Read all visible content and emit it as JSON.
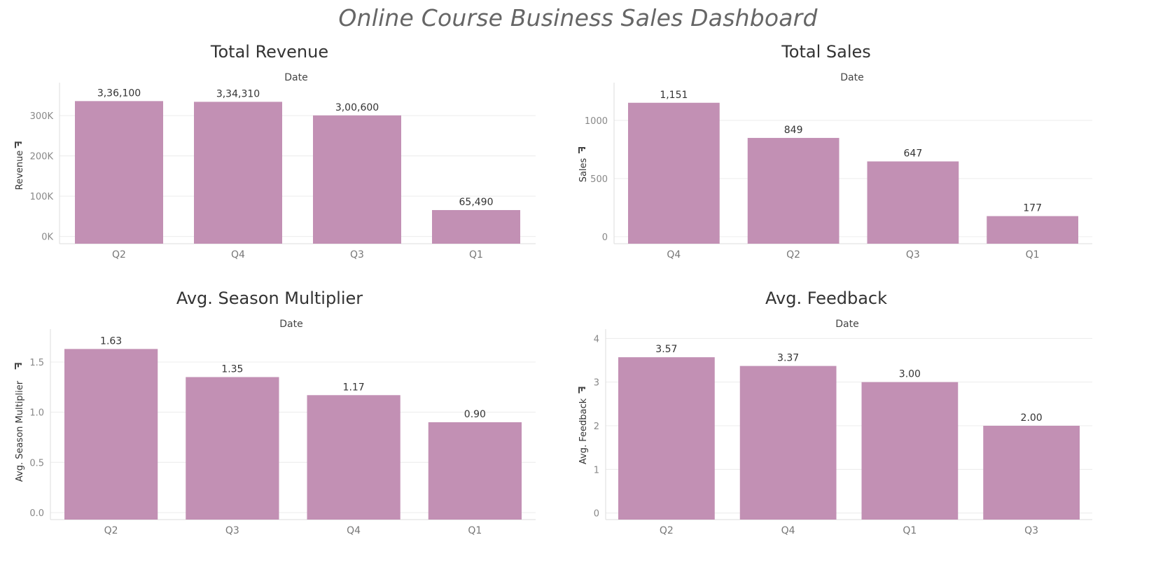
{
  "dashboard": {
    "title": "Online Course Business Sales Dashboard"
  },
  "colors": {
    "bar": "#c290b4"
  },
  "chart_data": [
    {
      "type": "bar",
      "title": "Total Revenue",
      "column_header": "Date",
      "ylabel": "Revenue",
      "categories": [
        "Q2",
        "Q4",
        "Q3",
        "Q1"
      ],
      "values": [
        336100,
        334310,
        300600,
        65490
      ],
      "value_labels": [
        "3,36,100",
        "3,34,310",
        "3,00,600",
        "65,490"
      ],
      "yticks": [
        0,
        100000,
        200000,
        300000
      ],
      "ytick_labels": [
        "0K",
        "100K",
        "200K",
        "300K"
      ],
      "ylim": [
        -18000,
        375000
      ]
    },
    {
      "type": "bar",
      "title": "Total Sales",
      "column_header": "Date",
      "ylabel": "Sales",
      "categories": [
        "Q4",
        "Q2",
        "Q3",
        "Q1"
      ],
      "values": [
        1151,
        849,
        647,
        177
      ],
      "value_labels": [
        "1,151",
        "849",
        "647",
        "177"
      ],
      "yticks": [
        0,
        500,
        1000
      ],
      "ytick_labels": [
        "0",
        "500",
        "1000"
      ],
      "ylim": [
        -60,
        1300
      ]
    },
    {
      "type": "bar",
      "title": "Avg. Season Multiplier",
      "column_header": "Date",
      "ylabel": "Avg. Season Multiplier",
      "categories": [
        "Q2",
        "Q3",
        "Q4",
        "Q1"
      ],
      "values": [
        1.63,
        1.35,
        1.17,
        0.9
      ],
      "value_labels": [
        "1.63",
        "1.35",
        "1.17",
        "0.90"
      ],
      "yticks": [
        0,
        0.5,
        1.0,
        1.5
      ],
      "ytick_labels": [
        "0.0",
        "0.5",
        "1.0",
        "1.5"
      ],
      "ylim": [
        -0.07,
        1.8
      ]
    },
    {
      "type": "bar",
      "title": "Avg. Feedback",
      "column_header": "Date",
      "ylabel": "Avg. Feedback",
      "categories": [
        "Q2",
        "Q4",
        "Q1",
        "Q3"
      ],
      "values": [
        3.57,
        3.37,
        3.0,
        2.0
      ],
      "value_labels": [
        "3.57",
        "3.37",
        "3.00",
        "2.00"
      ],
      "yticks": [
        0,
        1,
        2,
        3,
        4
      ],
      "ytick_labels": [
        "0",
        "1",
        "2",
        "3",
        "4"
      ],
      "ylim": [
        -0.15,
        4.15
      ]
    }
  ]
}
